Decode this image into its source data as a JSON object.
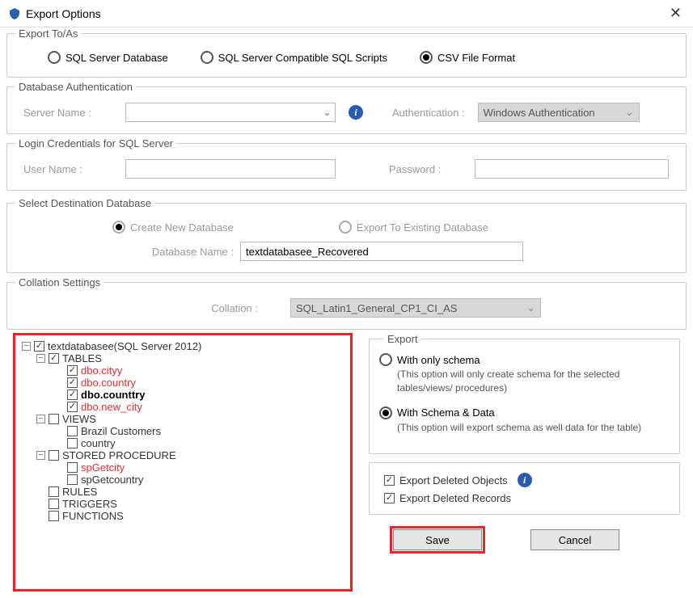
{
  "window": {
    "title": "Export Options"
  },
  "exportToAs": {
    "legend": "Export To/As",
    "options": {
      "sqlServer": "SQL Server Database",
      "scripts": "SQL Server Compatible SQL Scripts",
      "csv": "CSV File Format"
    }
  },
  "dbAuth": {
    "legend": "Database Authentication",
    "serverLabel": "Server Name :",
    "authLabel": "Authentication :",
    "authValue": "Windows Authentication"
  },
  "login": {
    "legend": "Login Credentials for SQL Server",
    "userLabel": "User Name :",
    "passLabel": "Password :"
  },
  "destDb": {
    "legend": "Select Destination Database",
    "createNew": "Create New Database",
    "exportExisting": "Export To Existing Database",
    "dbNameLabel": "Database Name :",
    "dbNameValue": "textdatabasee_Recovered"
  },
  "collation": {
    "legend": "Collation Settings",
    "label": "Collation :",
    "value": "SQL_Latin1_General_CP1_CI_AS"
  },
  "tree": {
    "root": "textdatabasee(SQL Server 2012)",
    "tables": "TABLES",
    "t_city": "dbo.cityy",
    "t_country": "dbo.country",
    "t_counttry": "dbo.counttry",
    "t_newcity": "dbo.new_city",
    "views": "VIEWS",
    "v_brazil": "Brazil Customers",
    "v_country": "country",
    "sp": "STORED PROCEDURE",
    "sp_getcity": "spGetcity",
    "sp_getcountry": "spGetcountry",
    "rules": "RULES",
    "triggers": "TRIGGERS",
    "functions": "FUNCTIONS"
  },
  "export": {
    "legend": "Export",
    "schemaOnly": "With only schema",
    "schemaOnlyDesc": "(This option will only create schema for the  selected tables/views/ procedures)",
    "schemaData": "With Schema & Data",
    "schemaDataDesc": "(This option will export schema as well data for the table)",
    "delObjects": "Export Deleted Objects",
    "delRecords": "Export Deleted Records",
    "save": "Save",
    "cancel": "Cancel"
  }
}
